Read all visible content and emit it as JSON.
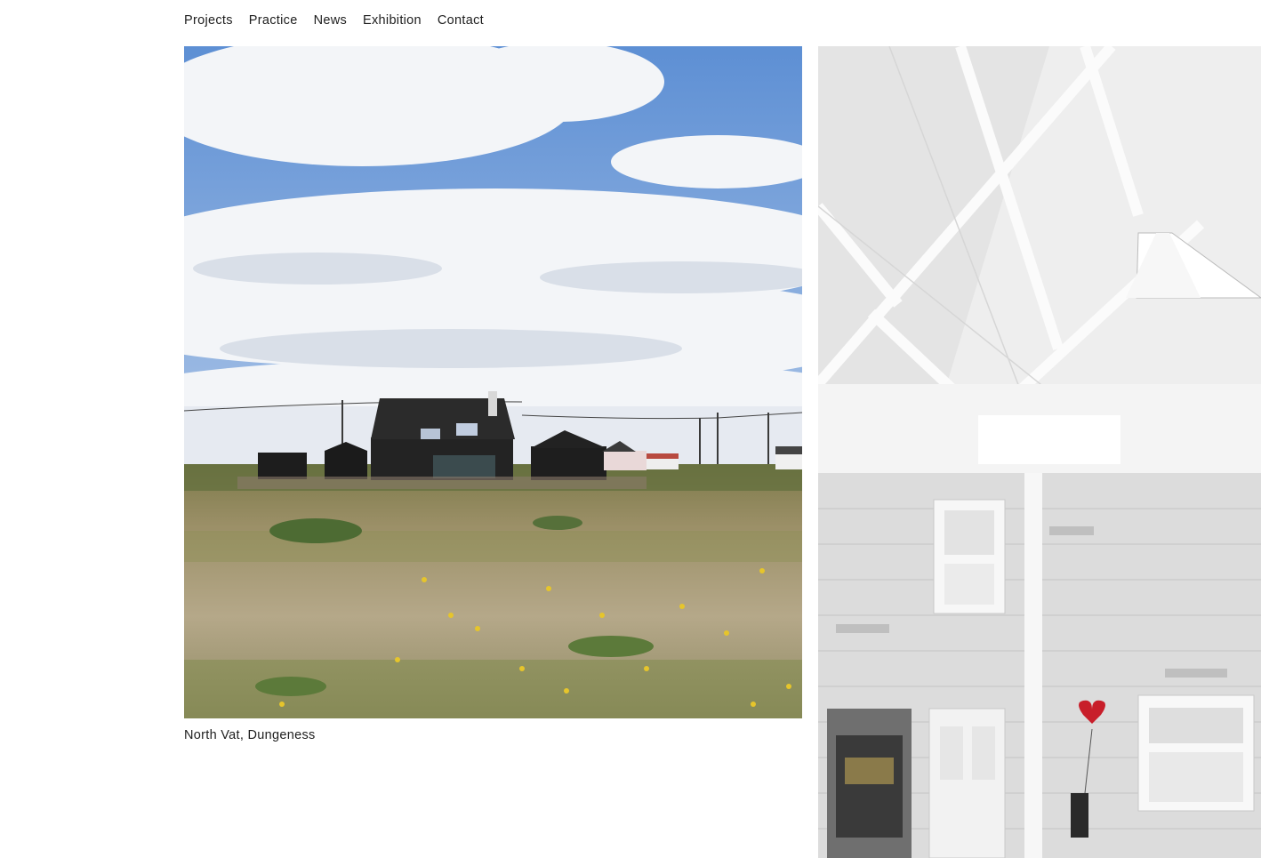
{
  "nav": {
    "items": [
      "Projects",
      "Practice",
      "News",
      "Exhibition",
      "Contact"
    ]
  },
  "projects": [
    {
      "caption": "North Vat, Dungeness",
      "image": "photo of a black-clad house on a shingle beach under a cloudy blue sky"
    },
    {
      "caption": "",
      "image": "photo of a white-painted brick interior with an exposed pitched roof and skylight"
    }
  ],
  "colors": {
    "text": "#1e1e1e",
    "background": "#ffffff",
    "sky": "#6f9bd6"
  }
}
